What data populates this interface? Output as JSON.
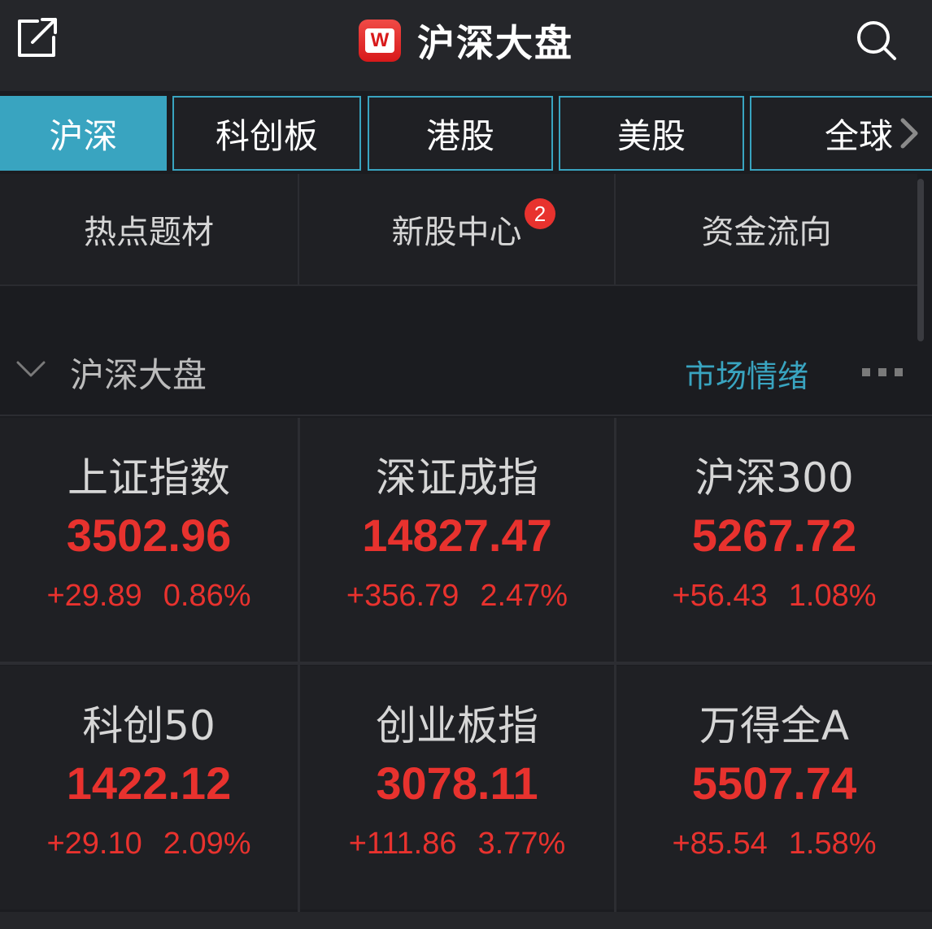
{
  "header": {
    "title": "沪深大盘",
    "logo_letter": "W",
    "share_icon": "share-external-icon",
    "search_icon": "search-icon"
  },
  "tabs": [
    {
      "label": "沪深",
      "active": true
    },
    {
      "label": "科创板",
      "active": false
    },
    {
      "label": "港股",
      "active": false
    },
    {
      "label": "美股",
      "active": false
    },
    {
      "label": "全球",
      "active": false
    }
  ],
  "quick_entries": [
    {
      "label": "热点题材"
    },
    {
      "label": "新股中心",
      "badge": "2"
    },
    {
      "label": "资金流向"
    }
  ],
  "section": {
    "title": "沪深大盘",
    "link": "市场情绪",
    "collapse_icon": "chevron-down-icon",
    "more_icon": "more-dots-icon"
  },
  "indices": [
    {
      "name": "上证指数",
      "value": "3502.96",
      "change": "+29.89",
      "percent": "0.86%"
    },
    {
      "name": "深证成指",
      "value": "14827.47",
      "change": "+356.79",
      "percent": "2.47%"
    },
    {
      "name": "沪深300",
      "value": "5267.72",
      "change": "+56.43",
      "percent": "1.08%"
    },
    {
      "name": "科创50",
      "value": "1422.12",
      "change": "+29.10",
      "percent": "2.09%"
    },
    {
      "name": "创业板指",
      "value": "3078.11",
      "change": "+111.86",
      "percent": "3.77%"
    },
    {
      "name": "万得全A",
      "value": "5507.74",
      "change": "+85.54",
      "percent": "1.58%"
    }
  ],
  "colors": {
    "up": "#e8322e",
    "accent": "#39a4c0",
    "background": "#1b1c20"
  }
}
